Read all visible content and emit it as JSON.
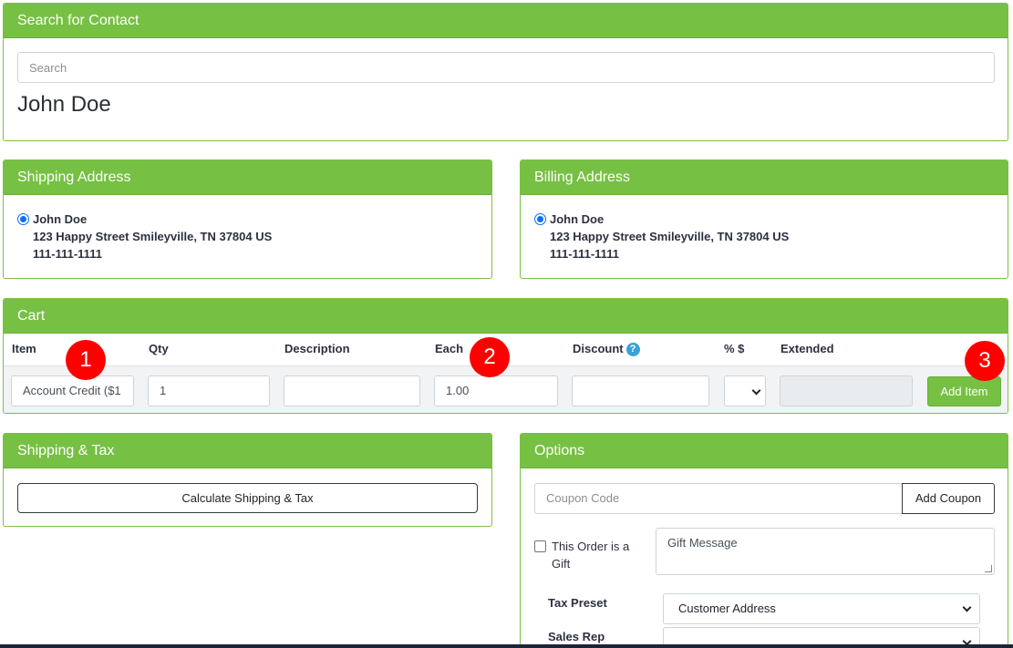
{
  "contact": {
    "header": "Search for Contact",
    "search_placeholder": "Search",
    "name": "John Doe"
  },
  "shipping_address": {
    "header": "Shipping Address",
    "name": "John Doe",
    "street": "123 Happy Street Smileyville, TN 37804 US",
    "phone": "111-111-1111"
  },
  "billing_address": {
    "header": "Billing Address",
    "name": "John Doe",
    "street": "123 Happy Street Smileyville, TN 37804 US",
    "phone": "111-111-1111"
  },
  "cart": {
    "header": "Cart",
    "columns": {
      "item": "Item",
      "qty": "Qty",
      "description": "Description",
      "each": "Each",
      "discount": "Discount",
      "pct_dollar": "% $",
      "extended": "Extended"
    },
    "help_icon": "?",
    "item_value": "Account Credit ($1",
    "qty_value": "1",
    "description_value": "",
    "each_value": "1.00",
    "discount_value": "",
    "extended_value": "",
    "add_item_label": "Add Item"
  },
  "badges": [
    "1",
    "2",
    "3"
  ],
  "shipping_tax": {
    "header": "Shipping & Tax",
    "calc_label": "Calculate Shipping & Tax"
  },
  "options": {
    "header": "Options",
    "coupon_placeholder": "Coupon Code",
    "add_coupon_label": "Add Coupon",
    "gift_label": "This Order is a Gift",
    "gift_checked": false,
    "gift_message_placeholder": "Gift Message",
    "tax_preset_label": "Tax Preset",
    "tax_preset_value": "Customer Address",
    "sales_rep_label": "Sales Rep",
    "sales_rep_value": ""
  },
  "colors": {
    "header_green": "#76c043",
    "badge_red": "#ff0000",
    "help_blue": "#3aa2d6"
  }
}
